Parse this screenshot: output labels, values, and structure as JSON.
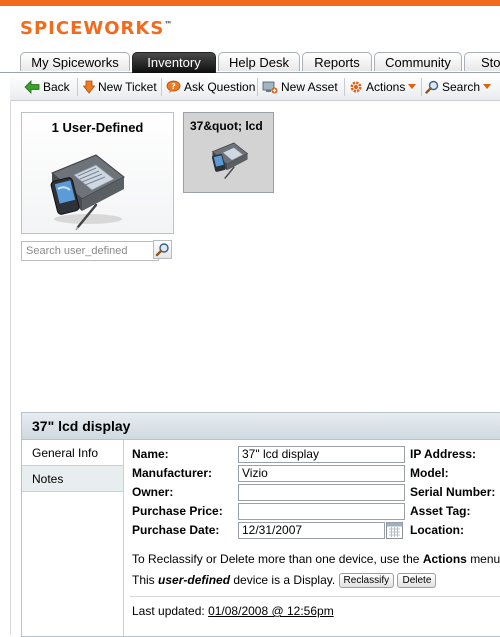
{
  "brand": {
    "logo_text": "SPICEWORKS",
    "accent": "#f26b1d"
  },
  "tabs": [
    {
      "label": "My Spiceworks",
      "active": false
    },
    {
      "label": "Inventory",
      "active": true
    },
    {
      "label": "Help Desk",
      "active": false
    },
    {
      "label": "Reports",
      "active": false
    },
    {
      "label": "Community",
      "active": false
    },
    {
      "label": "Sto",
      "active": false
    }
  ],
  "toolbar": {
    "back": "Back",
    "new_ticket": "New Ticket",
    "ask_question": "Ask Question",
    "new_asset": "New Asset",
    "actions": "Actions",
    "search": "Search"
  },
  "groups": {
    "user_defined": {
      "title": "1 User-Defined",
      "icon": "pda-device-icon"
    },
    "lcd": {
      "title": "37&quot; lcd",
      "icon": "pda-device-icon"
    }
  },
  "group_search": {
    "placeholder": "Search user_defined"
  },
  "detail": {
    "title": "37\" lcd display",
    "tabs": [
      {
        "label": "General Info",
        "active": true
      },
      {
        "label": "Notes",
        "active": false
      }
    ],
    "fields": {
      "name_label": "Name:",
      "name_value": "37\" lcd display",
      "manufacturer_label": "Manufacturer:",
      "manufacturer_value": "Vizio",
      "owner_label": "Owner:",
      "owner_value": "",
      "purchase_price_label": "Purchase Price:",
      "purchase_price_value": "",
      "purchase_date_label": "Purchase Date:",
      "purchase_date_value": "12/31/2007",
      "ip_label": "IP Address:",
      "model_label": "Model:",
      "serial_label": "Serial Number:",
      "asset_tag_label": "Asset Tag:",
      "location_label": "Location:"
    },
    "reclassify_msg_pre": "To Reclassify or Delete more than one device, use the",
    "reclassify_msg_bold": "Actions",
    "reclassify_msg_post": "menu",
    "device_msg_pre": "This",
    "device_msg_bold": "user-defined",
    "device_msg_post": "device is a Display.",
    "reclassify_button": "Reclassify",
    "delete_button": "Delete",
    "last_updated_label": "Last updated:",
    "last_updated_value": "01/08/2008 @ 12:56pm"
  }
}
